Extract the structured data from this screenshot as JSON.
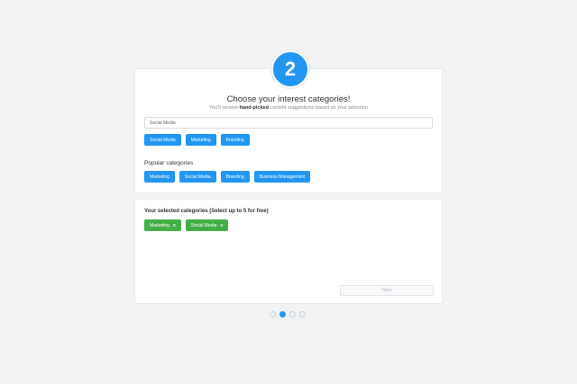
{
  "step": {
    "number": "2"
  },
  "header": {
    "title": "Choose your interest categories!",
    "subtitle_before": "You'll receive ",
    "subtitle_bold": "hand-picked",
    "subtitle_after": " content suggestions based on your selection"
  },
  "search": {
    "value": "Social Media",
    "placeholder": ""
  },
  "suggestions": [
    "Social Media",
    "Marketing",
    "Branding"
  ],
  "popular": {
    "title": "Popular categories",
    "items": [
      "Marketing",
      "Social Media",
      "Branding",
      "Business Management"
    ]
  },
  "selected": {
    "title": "Your selected categories (Select up to 5 for free)",
    "items": [
      "Marketing",
      "Social Media"
    ],
    "remove_symbol": "x"
  },
  "next_button": {
    "label": "Next"
  },
  "pagination": {
    "total": 4,
    "active": 2
  },
  "colors": {
    "accent": "#2196f3",
    "selected_tag": "#43b047",
    "background": "#f0f2f4"
  }
}
